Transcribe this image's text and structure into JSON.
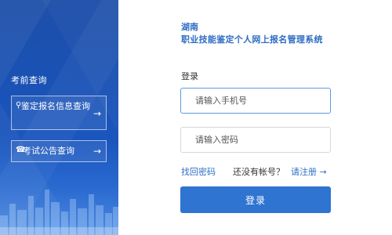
{
  "sidebar": {
    "title": "考前查询",
    "buttons": [
      {
        "label": "鉴定报名信息查询",
        "icon": "search-icon",
        "arrow": "→"
      },
      {
        "label": "考试公告查询",
        "icon": "megaphone-icon",
        "arrow": "→"
      }
    ]
  },
  "brand": {
    "line1": "湖南",
    "line2": "职业技能鉴定个人网上报名管理系统"
  },
  "login": {
    "heading": "登录",
    "phone_placeholder": "请输入手机号",
    "password_placeholder": "请输入密码",
    "forgot_label": "找回密码",
    "no_account_label": "还没有帐号？",
    "register_label": "请注册 →",
    "submit_label": "登录"
  },
  "colors": {
    "sidebar_bg": "#1b56bd",
    "accent": "#2f74d0",
    "link": "#2f70c4"
  }
}
